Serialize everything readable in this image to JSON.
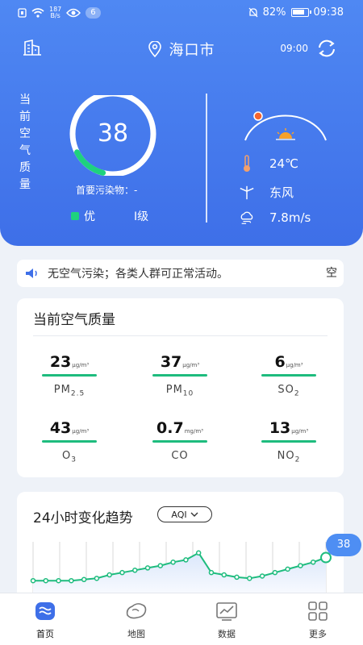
{
  "status_bar": {
    "net_speed_top": "187",
    "net_speed_bottom": "B/s",
    "badge": "6",
    "battery": "82%",
    "time": "09:38"
  },
  "header": {
    "city": "海口市",
    "update_time": "09:00",
    "aq_label": "当前空气质量",
    "aqi": "38",
    "aqi_fraction": 0.15,
    "primary_pollutant": "首要污染物：-",
    "level": "优",
    "grade": "I级",
    "temperature": "24℃",
    "wind_direction": "东风",
    "wind_speed": "7.8m/s"
  },
  "notice": {
    "text": "无空气污染；各类人群可正常活动。",
    "overflow": "空"
  },
  "current_card": {
    "title": "当前空气质量",
    "metrics": [
      {
        "value": "23",
        "unit": "μg/m³",
        "name": "PM",
        "sub": "2.5"
      },
      {
        "value": "37",
        "unit": "μg/m³",
        "name": "PM",
        "sub": "10"
      },
      {
        "value": "6",
        "unit": "μg/m³",
        "name": "SO",
        "sub": "2"
      },
      {
        "value": "43",
        "unit": "μg/m³",
        "name": "O",
        "sub": "3"
      },
      {
        "value": "0.7",
        "unit": "mg/m³",
        "name": "CO",
        "sub": ""
      },
      {
        "value": "13",
        "unit": "μg/m³",
        "name": "NO",
        "sub": "2"
      }
    ]
  },
  "trend": {
    "title": "24小时变化趋势",
    "selector": "AQI",
    "current_bubble": "38"
  },
  "chart_data": {
    "type": "area",
    "x": [
      0,
      1,
      2,
      3,
      4,
      5,
      6,
      7,
      8,
      9,
      10,
      11,
      12,
      13,
      14,
      15,
      16,
      17,
      18,
      19,
      20,
      21,
      22,
      23
    ],
    "values": [
      18,
      18,
      18,
      18,
      19,
      20,
      23,
      25,
      27,
      29,
      31,
      34,
      36,
      42,
      25,
      23,
      21,
      20,
      22,
      25,
      28,
      31,
      34,
      38
    ],
    "ylim": [
      0,
      60
    ]
  },
  "colors": {
    "primary": "#3e6fe8",
    "good": "#1ed27e",
    "line": "#1ebc7e"
  },
  "bottom_nav": [
    {
      "label": "首页",
      "icon": "home-wave-icon"
    },
    {
      "label": "地图",
      "icon": "map-icon"
    },
    {
      "label": "数据",
      "icon": "data-chart-icon"
    },
    {
      "label": "更多",
      "icon": "grid-more-icon"
    }
  ]
}
